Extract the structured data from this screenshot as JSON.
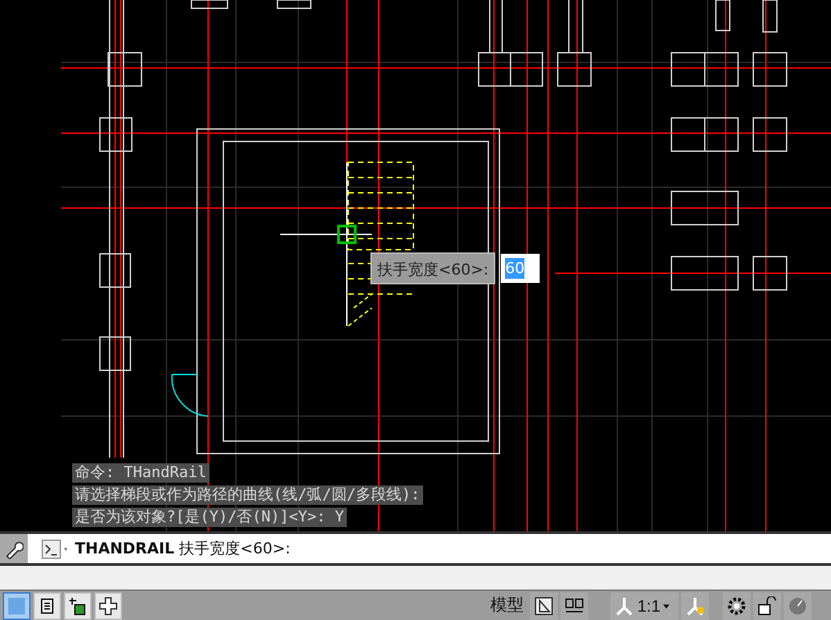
{
  "command_history": [
    "命令: THandRail",
    "请选择梯段或作为路径的曲线(线/弧/圆/多段线):",
    "是否为该对象?[是(Y)/否(N)]<Y>: Y"
  ],
  "dynamic_input": {
    "prompt": "扶手宽度<60>:",
    "value": "60"
  },
  "command_line": {
    "command": "THANDRAIL",
    "prompt": "扶手宽度<60>:"
  },
  "status_bar": {
    "view_buttons": [
      {
        "selected": true
      },
      {
        "selected": false
      },
      {
        "selected": false
      },
      {
        "selected": false
      }
    ],
    "model_label": "模型",
    "scale": "1:1"
  }
}
